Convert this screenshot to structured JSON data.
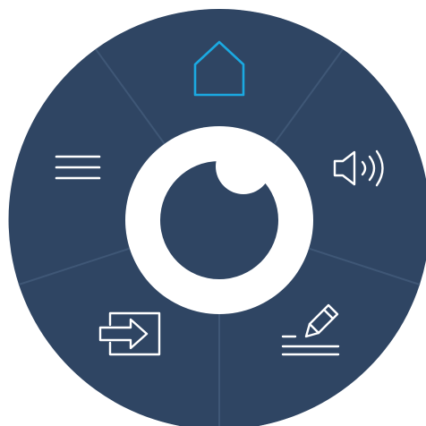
{
  "menu": {
    "colors": {
      "background": "#2f4563",
      "divider": "#3e5675",
      "icon": "#ffffff",
      "active_icon": "#1ba9e1",
      "hub_ring": "#ffffff",
      "hub_center": "#2f4563"
    },
    "segments": [
      {
        "id": "home",
        "icon": "home-icon",
        "active": true
      },
      {
        "id": "volume",
        "icon": "speaker-volume-icon",
        "active": false
      },
      {
        "id": "edit",
        "icon": "pencil-write-icon",
        "active": false
      },
      {
        "id": "input",
        "icon": "input-arrow-icon",
        "active": false
      },
      {
        "id": "menu",
        "icon": "hamburger-menu-icon",
        "active": false
      }
    ],
    "center": {
      "icon": "eye-logo-icon"
    }
  }
}
